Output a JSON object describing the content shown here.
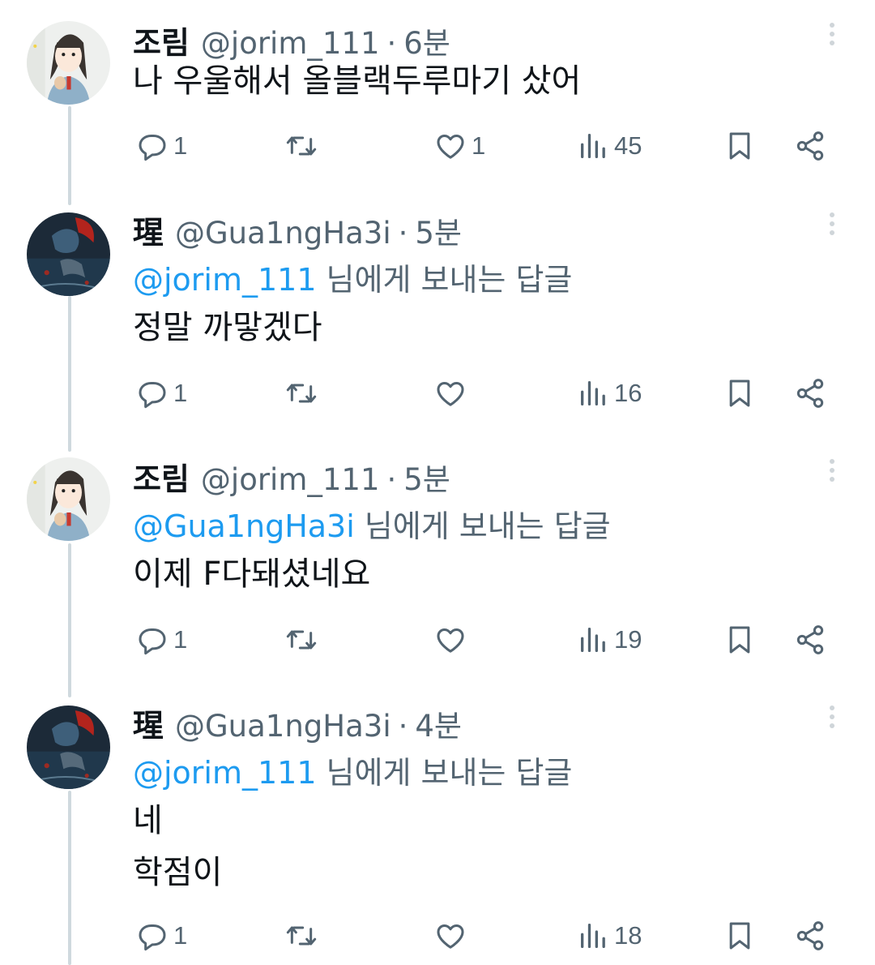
{
  "tweets": [
    {
      "name": "조림",
      "handle": "@jorim_111",
      "dot": "·",
      "time": "6분",
      "reply_to": "",
      "reply_suffix": "",
      "lines": [
        "나 우울해서 올블랙두루마기 샀어"
      ],
      "replies": "1",
      "retweets": "",
      "likes": "1",
      "views": "45",
      "avatar": "girl-avatar"
    },
    {
      "name": "瑆",
      "handle": "@Gua1ngHa3i",
      "dot": "·",
      "time": "5분",
      "reply_to": "@jorim_111",
      "reply_suffix": "님에게 보내는 답글",
      "lines": [
        "정말 까맣겠다"
      ],
      "replies": "1",
      "retweets": "",
      "likes": "",
      "views": "16",
      "avatar": "dark-art-avatar"
    },
    {
      "name": "조림",
      "handle": "@jorim_111",
      "dot": "·",
      "time": "5분",
      "reply_to": "@Gua1ngHa3i",
      "reply_suffix": "님에게 보내는 답글",
      "lines": [
        "이제 F다돼셨네요"
      ],
      "replies": "1",
      "retweets": "",
      "likes": "",
      "views": "19",
      "avatar": "girl-avatar"
    },
    {
      "name": "瑆",
      "handle": "@Gua1ngHa3i",
      "dot": "·",
      "time": "4분",
      "reply_to": "@jorim_111",
      "reply_suffix": "님에게 보내는 답글",
      "lines": [
        "네",
        "학점이"
      ],
      "replies": "1",
      "retweets": "",
      "likes": "",
      "views": "18",
      "avatar": "dark-art-avatar"
    }
  ],
  "icons": {
    "reply": "reply-icon",
    "retweet": "retweet-icon",
    "like": "heart-icon",
    "views": "views-icon",
    "bookmark": "bookmark-icon",
    "share": "share-icon",
    "more": "more-icon"
  },
  "colors": {
    "text": "#0f1419",
    "secondary": "#536471",
    "link": "#1d9bf0",
    "thread_line": "#cfd9de"
  }
}
